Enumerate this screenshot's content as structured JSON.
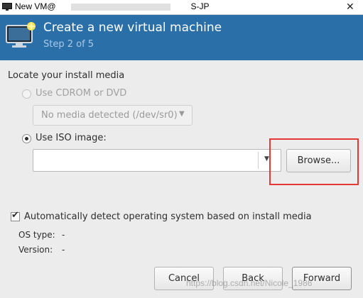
{
  "window": {
    "title_prefix": "New VM@",
    "title_suffix": "S-JP",
    "close_icon": "close-icon"
  },
  "header": {
    "title": "Create a new virtual machine",
    "step": "Step 2 of 5",
    "icon": "monitor-icon",
    "background_color": "#2a6fa8"
  },
  "install_media": {
    "section_label": "Locate your install media",
    "cdrom_option": {
      "label": "Use CDROM or DVD",
      "selected": false,
      "enabled": false,
      "dropdown_value": "No media detected (/dev/sr0)"
    },
    "iso_option": {
      "label": "Use ISO image:",
      "selected": true,
      "path_value": ""
    },
    "browse_label": "Browse..."
  },
  "os_detection": {
    "auto_detect_label": "Automatically detect operating system based on install media",
    "checked": true,
    "os_type_label": "OS type:",
    "os_type_value": "-",
    "version_label": "Version:",
    "version_value": "-"
  },
  "footer": {
    "cancel_label": "Cancel",
    "back_label": "Back",
    "forward_label": "Forward"
  },
  "watermark": "https://blog.csdn.net/Nicole_1986",
  "highlight_color": "#e53935"
}
